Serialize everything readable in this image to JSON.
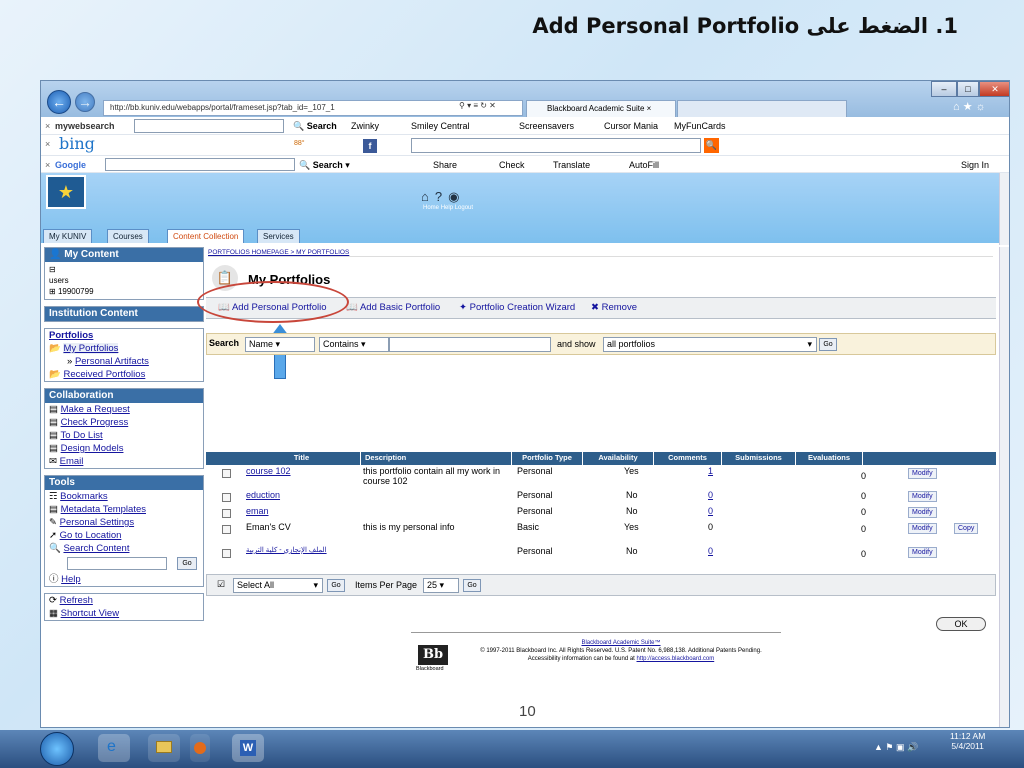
{
  "slide": {
    "title": "1. الضغط على Add Personal Portfolio",
    "page_number": "10"
  },
  "browser": {
    "address": "http://bb.kuniv.edu/webapps/portal/frameset.jsp?tab_id=_107_1",
    "tab_title": "Blackboard Academic Suite",
    "right_icons": "⌂ ★ ☼",
    "toolbar1": {
      "brand": "mywebsearch",
      "search_label": "Search",
      "zwinky": "Zwinky",
      "smiley": "Smiley Central",
      "screensavers": "Screensavers",
      "cursor": "Cursor Mania",
      "myfuncards": "MyFunCards"
    },
    "toolbar2": {
      "brand": "bing",
      "temp": "88°"
    },
    "toolbar3": {
      "brand": "Google",
      "search": "Search",
      "share": "Share",
      "check": "Check",
      "translate": "Translate",
      "autofill": "AutoFill",
      "signin": "Sign In"
    }
  },
  "header": {
    "links": [
      "Home",
      "Help",
      "Logout"
    ],
    "tabs": [
      "My KUNIV",
      "Courses",
      "Content Collection",
      "Services"
    ]
  },
  "sidebar": {
    "my_content": {
      "title": "My Content",
      "items": [
        "users",
        "19900799"
      ]
    },
    "institution": {
      "title": "Institution Content"
    },
    "portfolios": {
      "title": "Portfolios",
      "items": [
        "My Portfolios",
        "Personal Artifacts",
        "Received Portfolios"
      ]
    },
    "collaboration": {
      "title": "Collaboration",
      "items": [
        "Make a Request",
        "Check Progress",
        "To Do List",
        "Design Models",
        "Email"
      ]
    },
    "tools": {
      "title": "Tools",
      "items": [
        "Bookmarks",
        "Metadata Templates",
        "Personal Settings",
        "Go to Location",
        "Search Content"
      ],
      "go": "Go",
      "help": "Help"
    },
    "bottom": [
      "Refresh",
      "Shortcut View"
    ]
  },
  "main": {
    "breadcrumb": "PORTFOLIOS HOMEPAGE > MY PORTFOLIOS",
    "title": "My Portfolios",
    "actions": [
      "Add Personal Portfolio",
      "Add Basic Portfolio",
      "Portfolio Creation Wizard",
      "Remove"
    ],
    "search": {
      "label": "Search",
      "field": "Name",
      "op": "Contains",
      "value": "",
      "and_show": "and show",
      "show": "all portfolios",
      "go": "Go"
    },
    "columns": [
      "Title",
      "Description",
      "Portfolio Type",
      "Availability",
      "Comments",
      "Submissions",
      "Evaluations"
    ],
    "rows": [
      {
        "title": "course 102",
        "desc": "this portfolio contain all my work in course 102",
        "type": "Personal",
        "avail": "Yes",
        "comments": "1",
        "evals": "0",
        "action": "Modify"
      },
      {
        "title": "eduction",
        "desc": "",
        "type": "Personal",
        "avail": "No",
        "comments": "0",
        "evals": "0",
        "action": "Modify"
      },
      {
        "title": "eman",
        "desc": "",
        "type": "Personal",
        "avail": "No",
        "comments": "0",
        "evals": "0",
        "action": "Modify"
      },
      {
        "title": "Eman's CV",
        "desc": "this is my personal info",
        "type": "Basic",
        "avail": "Yes",
        "comments": "0",
        "evals": "0",
        "action": "Modify",
        "copy": "Copy"
      },
      {
        "title": "الملف الإنجازي - كلية التربية",
        "desc": "",
        "type": "Personal",
        "avail": "No",
        "comments": "0",
        "evals": "0",
        "action": "Modify"
      }
    ],
    "select_all": "Select All",
    "go": "Go",
    "items_per_page_label": "Items Per Page",
    "items_per_page": "25",
    "ok": "OK",
    "footer": {
      "logo": "Bb",
      "logo_sub": "Blackboard",
      "suite": "Blackboard Academic Suite™",
      "copyright": "© 1997-2011 Blackboard Inc. All Rights Reserved. U.S. Patent No. 6,988,138. Additional Patents Pending.",
      "access_pre": "Accessibility information can be found at",
      "access_url": "http://access.blackboard.com"
    }
  },
  "taskbar": {
    "time": "11:12 AM",
    "date": "5/4/2011"
  }
}
